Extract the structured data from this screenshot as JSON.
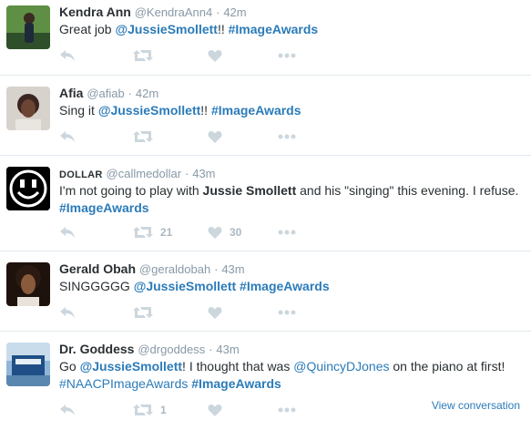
{
  "tweets": [
    {
      "name": "Kendra Ann",
      "handle": "@KendraAnn4",
      "time": "42m",
      "text": {
        "pre": "Great job ",
        "mention": "@JussieSmollett",
        "mid": "!! ",
        "hashtag": "#ImageAwards"
      },
      "retweets": "",
      "likes": ""
    },
    {
      "name": "Afia",
      "handle": "@afiab",
      "time": "42m",
      "text": {
        "pre": "Sing it ",
        "mention": "@JussieSmollett",
        "mid": "!! ",
        "hashtag": "#ImageAwards"
      },
      "retweets": "",
      "likes": ""
    },
    {
      "name": "DOLLAR",
      "handle": "@callmedollar",
      "time": "43m",
      "text": {
        "pre": "I'm not going to play with ",
        "bold": "Jussie Smollett",
        "post": " and his \"singing\" this evening. I refuse. ",
        "hashtag": "#ImageAwards"
      },
      "retweets": "21",
      "likes": "30"
    },
    {
      "name": "Gerald Obah",
      "handle": "@geraldobah",
      "time": "43m",
      "text": {
        "pre": "SINGGGGG ",
        "mention": "@JussieSmollett",
        "mid": " ",
        "hashtag": "#ImageAwards"
      },
      "retweets": "",
      "likes": ""
    },
    {
      "name": "Dr. Goddess",
      "handle": "@drgoddess",
      "time": "43m",
      "text": {
        "pre": "Go ",
        "mention": "@JussieSmollett",
        "mid": "! I thought that was ",
        "mention2": "@QuincyDJones",
        "mid2": " on the piano at first! ",
        "hashtag1": "#NAACPImageAwards",
        "sep": " ",
        "hashtag": "#ImageAwards"
      },
      "retweets": "1",
      "likes": "",
      "view_conversation": "View conversation"
    }
  ],
  "icons": [
    "reply-icon",
    "retweet-icon",
    "like-icon",
    "more-icon"
  ],
  "colors": {
    "link": "#2b7bb9",
    "muted": "#8899a6",
    "icon": "#ccd6dd",
    "divider": "#e1e8ed"
  }
}
